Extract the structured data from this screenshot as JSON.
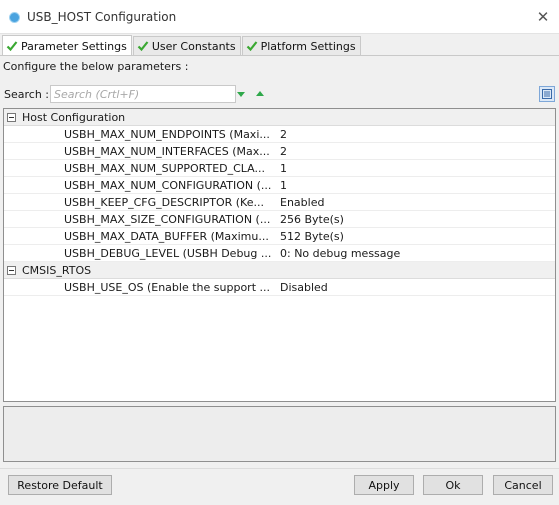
{
  "window": {
    "title": "USB_HOST Configuration",
    "close_glyph": "✕"
  },
  "tabs": [
    {
      "label": "Parameter Settings",
      "active": true
    },
    {
      "label": "User Constants",
      "active": false
    },
    {
      "label": "Platform Settings",
      "active": false
    }
  ],
  "description": "Configure the below parameters :",
  "search": {
    "label": "Search :",
    "placeholder": "Search (Crtl+F)",
    "value": ""
  },
  "groups": [
    {
      "name": "Host Configuration",
      "params": [
        {
          "name": "USBH_MAX_NUM_ENDPOINTS (Maxi...",
          "value": "2"
        },
        {
          "name": "USBH_MAX_NUM_INTERFACES (Max...",
          "value": "2"
        },
        {
          "name": "USBH_MAX_NUM_SUPPORTED_CLA...",
          "value": "1"
        },
        {
          "name": "USBH_MAX_NUM_CONFIGURATION (...",
          "value": "1"
        },
        {
          "name": "USBH_KEEP_CFG_DESCRIPTOR (Ke...",
          "value": "Enabled"
        },
        {
          "name": "USBH_MAX_SIZE_CONFIGURATION (...",
          "value": "256 Byte(s)"
        },
        {
          "name": "USBH_MAX_DATA_BUFFER (Maximu...",
          "value": "512 Byte(s)"
        },
        {
          "name": "USBH_DEBUG_LEVEL (USBH Debug ...",
          "value": "0: No debug message"
        }
      ]
    },
    {
      "name": "CMSIS_RTOS",
      "params": [
        {
          "name": "USBH_USE_OS (Enable the support ...",
          "value": "Disabled"
        }
      ]
    }
  ],
  "buttons": {
    "restore_default": "Restore Default",
    "apply": "Apply",
    "ok": "Ok",
    "cancel": "Cancel"
  },
  "colors": {
    "check_green": "#3aa832",
    "arrow_green": "#2fa84a",
    "accent_blue": "#4aa3df"
  },
  "icons": {
    "app": "usb-host-icon",
    "tab_check": "check-icon",
    "expand_all": "green-down-arrow-icon",
    "collapse_all": "green-up-arrow-icon",
    "view_toggle": "list-view-icon"
  }
}
